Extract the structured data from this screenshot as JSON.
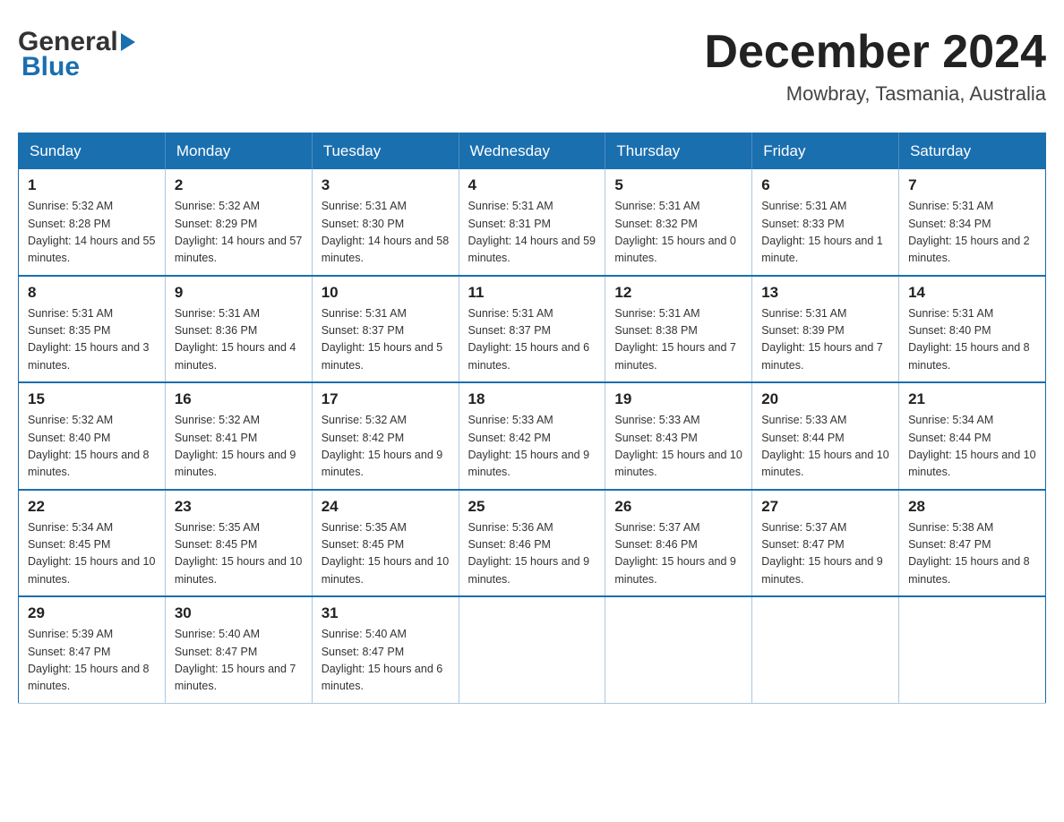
{
  "header": {
    "logo_general": "General",
    "logo_blue": "Blue",
    "month_title": "December 2024",
    "location": "Mowbray, Tasmania, Australia"
  },
  "weekdays": [
    "Sunday",
    "Monday",
    "Tuesday",
    "Wednesday",
    "Thursday",
    "Friday",
    "Saturday"
  ],
  "weeks": [
    [
      {
        "day": "1",
        "sunrise": "5:32 AM",
        "sunset": "8:28 PM",
        "daylight": "14 hours and 55 minutes."
      },
      {
        "day": "2",
        "sunrise": "5:32 AM",
        "sunset": "8:29 PM",
        "daylight": "14 hours and 57 minutes."
      },
      {
        "day": "3",
        "sunrise": "5:31 AM",
        "sunset": "8:30 PM",
        "daylight": "14 hours and 58 minutes."
      },
      {
        "day": "4",
        "sunrise": "5:31 AM",
        "sunset": "8:31 PM",
        "daylight": "14 hours and 59 minutes."
      },
      {
        "day": "5",
        "sunrise": "5:31 AM",
        "sunset": "8:32 PM",
        "daylight": "15 hours and 0 minutes."
      },
      {
        "day": "6",
        "sunrise": "5:31 AM",
        "sunset": "8:33 PM",
        "daylight": "15 hours and 1 minute."
      },
      {
        "day": "7",
        "sunrise": "5:31 AM",
        "sunset": "8:34 PM",
        "daylight": "15 hours and 2 minutes."
      }
    ],
    [
      {
        "day": "8",
        "sunrise": "5:31 AM",
        "sunset": "8:35 PM",
        "daylight": "15 hours and 3 minutes."
      },
      {
        "day": "9",
        "sunrise": "5:31 AM",
        "sunset": "8:36 PM",
        "daylight": "15 hours and 4 minutes."
      },
      {
        "day": "10",
        "sunrise": "5:31 AM",
        "sunset": "8:37 PM",
        "daylight": "15 hours and 5 minutes."
      },
      {
        "day": "11",
        "sunrise": "5:31 AM",
        "sunset": "8:37 PM",
        "daylight": "15 hours and 6 minutes."
      },
      {
        "day": "12",
        "sunrise": "5:31 AM",
        "sunset": "8:38 PM",
        "daylight": "15 hours and 7 minutes."
      },
      {
        "day": "13",
        "sunrise": "5:31 AM",
        "sunset": "8:39 PM",
        "daylight": "15 hours and 7 minutes."
      },
      {
        "day": "14",
        "sunrise": "5:31 AM",
        "sunset": "8:40 PM",
        "daylight": "15 hours and 8 minutes."
      }
    ],
    [
      {
        "day": "15",
        "sunrise": "5:32 AM",
        "sunset": "8:40 PM",
        "daylight": "15 hours and 8 minutes."
      },
      {
        "day": "16",
        "sunrise": "5:32 AM",
        "sunset": "8:41 PM",
        "daylight": "15 hours and 9 minutes."
      },
      {
        "day": "17",
        "sunrise": "5:32 AM",
        "sunset": "8:42 PM",
        "daylight": "15 hours and 9 minutes."
      },
      {
        "day": "18",
        "sunrise": "5:33 AM",
        "sunset": "8:42 PM",
        "daylight": "15 hours and 9 minutes."
      },
      {
        "day": "19",
        "sunrise": "5:33 AM",
        "sunset": "8:43 PM",
        "daylight": "15 hours and 10 minutes."
      },
      {
        "day": "20",
        "sunrise": "5:33 AM",
        "sunset": "8:44 PM",
        "daylight": "15 hours and 10 minutes."
      },
      {
        "day": "21",
        "sunrise": "5:34 AM",
        "sunset": "8:44 PM",
        "daylight": "15 hours and 10 minutes."
      }
    ],
    [
      {
        "day": "22",
        "sunrise": "5:34 AM",
        "sunset": "8:45 PM",
        "daylight": "15 hours and 10 minutes."
      },
      {
        "day": "23",
        "sunrise": "5:35 AM",
        "sunset": "8:45 PM",
        "daylight": "15 hours and 10 minutes."
      },
      {
        "day": "24",
        "sunrise": "5:35 AM",
        "sunset": "8:45 PM",
        "daylight": "15 hours and 10 minutes."
      },
      {
        "day": "25",
        "sunrise": "5:36 AM",
        "sunset": "8:46 PM",
        "daylight": "15 hours and 9 minutes."
      },
      {
        "day": "26",
        "sunrise": "5:37 AM",
        "sunset": "8:46 PM",
        "daylight": "15 hours and 9 minutes."
      },
      {
        "day": "27",
        "sunrise": "5:37 AM",
        "sunset": "8:47 PM",
        "daylight": "15 hours and 9 minutes."
      },
      {
        "day": "28",
        "sunrise": "5:38 AM",
        "sunset": "8:47 PM",
        "daylight": "15 hours and 8 minutes."
      }
    ],
    [
      {
        "day": "29",
        "sunrise": "5:39 AM",
        "sunset": "8:47 PM",
        "daylight": "15 hours and 8 minutes."
      },
      {
        "day": "30",
        "sunrise": "5:40 AM",
        "sunset": "8:47 PM",
        "daylight": "15 hours and 7 minutes."
      },
      {
        "day": "31",
        "sunrise": "5:40 AM",
        "sunset": "8:47 PM",
        "daylight": "15 hours and 6 minutes."
      },
      null,
      null,
      null,
      null
    ]
  ],
  "labels": {
    "sunrise": "Sunrise:",
    "sunset": "Sunset:",
    "daylight": "Daylight:"
  }
}
